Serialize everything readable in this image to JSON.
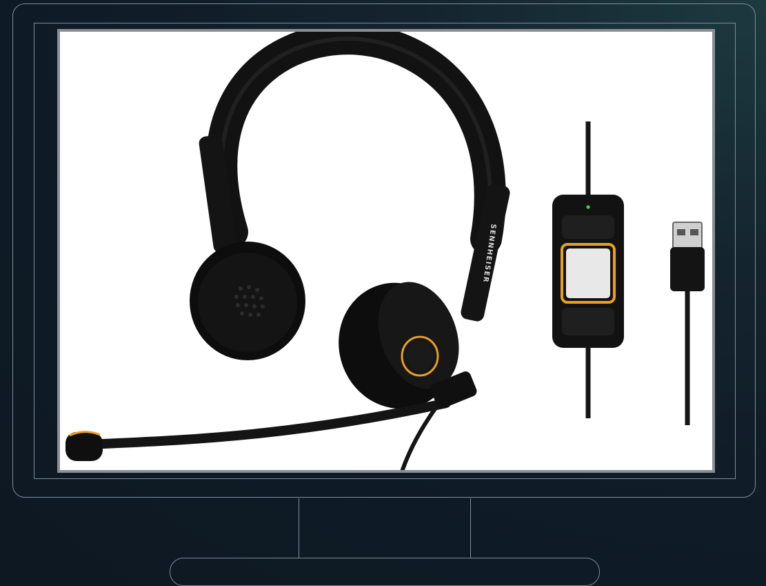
{
  "product": {
    "brand_wordmark": "SENNHEISER"
  },
  "colors": {
    "background": "#0f1b26",
    "outline": "#7d8e99",
    "headset_body": "#111111",
    "accent": "#e8a020",
    "screen_border": "#8b8f93"
  }
}
